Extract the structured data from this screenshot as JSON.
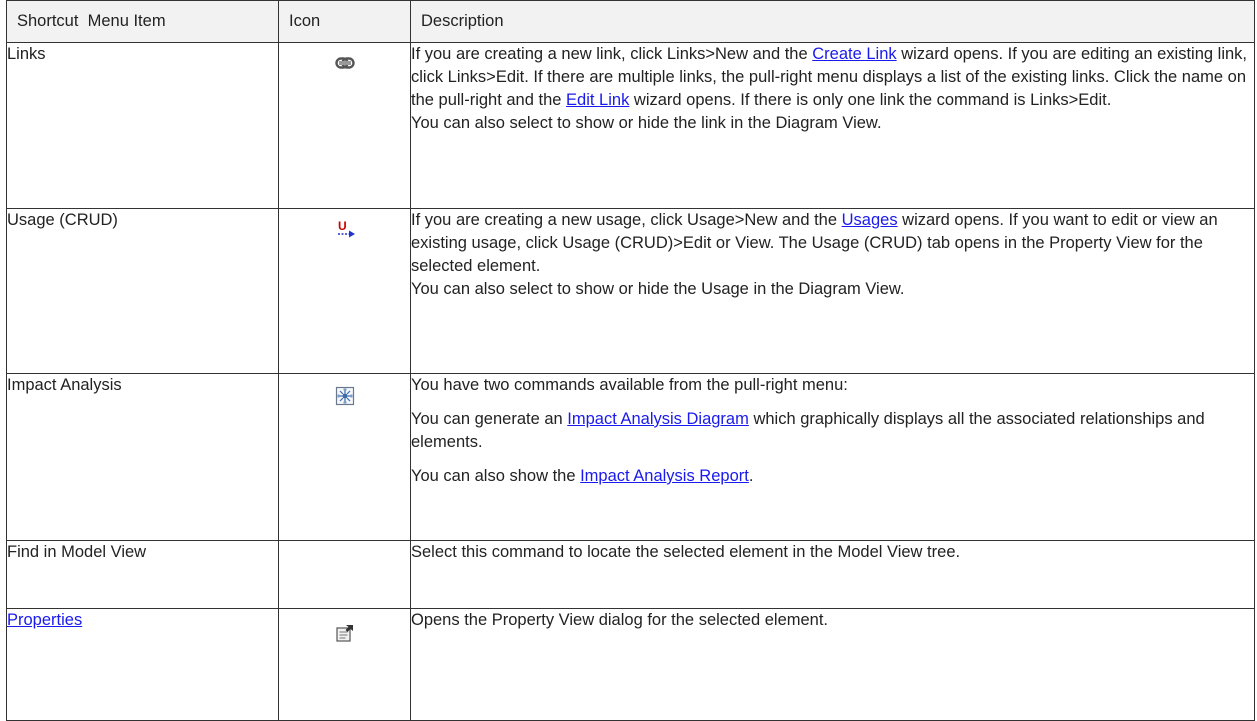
{
  "table": {
    "headers": {
      "item": "Shortcut  Menu Item",
      "icon": "Icon",
      "description": "Description"
    },
    "rows": {
      "links": {
        "item": "Links",
        "icon": "link-icon",
        "desc_1a": "If you are creating a new link, click Links>New and the ",
        "desc_1_link": "Create Link",
        "desc_1b": " wizard opens. If you are editing an existing link, click Links>Edit. If there are multiple links, the pull-right menu displays a list of the existing links. Click the name on the pull-right and the ",
        "desc_1_link2": "Edit Link",
        "desc_1c": " wizard opens. If there is only one link the command is Links>Edit.",
        "desc_2": "You can also select to show or hide the link in the Diagram View."
      },
      "usage": {
        "item": "Usage (CRUD)",
        "icon": "usage-arrow-icon",
        "desc_1a": "If you are creating a new usage, click Usage>New and the ",
        "desc_1_link": "Usages",
        "desc_1b": " wizard opens. If you want to edit or view an existing usage, click Usage (CRUD)>Edit or View. The Usage (CRUD) tab opens in the Property View for the selected element.",
        "desc_2": "You can also select to show or hide the Usage in the Diagram View."
      },
      "impact": {
        "item": "Impact Analysis",
        "icon": "impact-analysis-icon",
        "desc_1": "You have two commands available from the pull-right menu:",
        "desc_2a": "You can generate an ",
        "desc_2_link": "Impact Analysis Diagram",
        "desc_2b": " which graphically displays all the associated relationships and elements.",
        "desc_3a": "You can also show the ",
        "desc_3_link": "Impact Analysis Report",
        "desc_3b": "."
      },
      "find": {
        "item": "Find in Model View",
        "desc_1": "Select this command to locate the selected element in the Model View tree."
      },
      "properties": {
        "item": "Properties",
        "icon": "properties-icon",
        "desc_1": "Opens the Property View dialog for the selected element."
      }
    }
  },
  "colors": {
    "link": "#1a1aee",
    "header_bg": "#f2f2f2",
    "border": "#333333"
  }
}
